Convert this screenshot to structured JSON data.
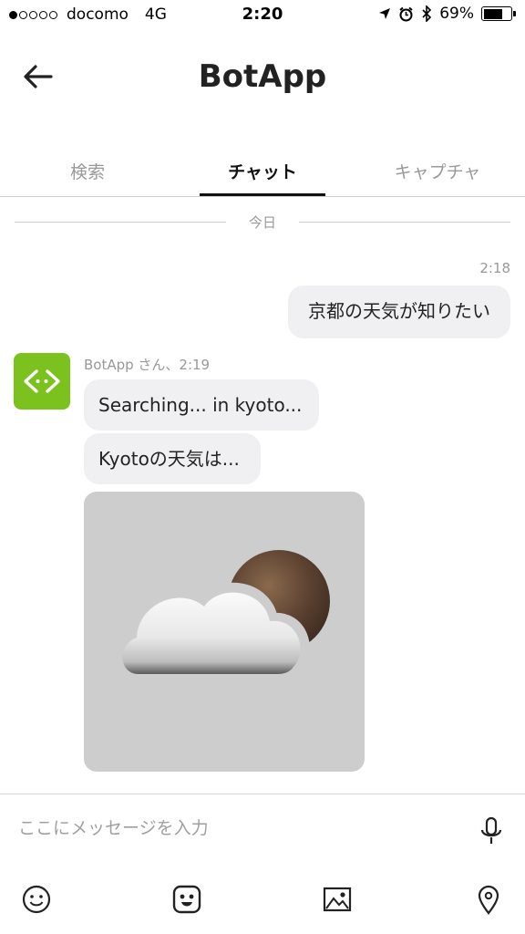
{
  "status_bar": {
    "carrier": "docomo",
    "network": "4G",
    "time": "2:20",
    "battery_percent": "69%",
    "battery_level": 0.69
  },
  "header": {
    "title": "BotApp",
    "back_icon": "back-arrow-icon"
  },
  "tabs": [
    {
      "label": "検索",
      "active": false
    },
    {
      "label": "チャット",
      "active": true
    },
    {
      "label": "キャプチャ",
      "active": false
    }
  ],
  "chat": {
    "date_divider": "今日",
    "messages": [
      {
        "from": "user",
        "time": "2:18",
        "text": "京都の天気が知りたい"
      },
      {
        "from": "bot",
        "meta": "BotApp さん、2:19",
        "text": "Searching... in kyoto..."
      },
      {
        "from": "bot",
        "text": "Kyotoの天気は..."
      },
      {
        "from": "bot",
        "image": "partly-cloudy-weather-icon"
      }
    ]
  },
  "composer": {
    "placeholder": "ここにメッセージを入力",
    "mic_icon": "microphone-icon"
  },
  "toolbar": {
    "icons": [
      "smiley-icon",
      "sticker-icon",
      "image-icon",
      "location-pin-icon"
    ]
  },
  "colors": {
    "avatar": "#7cc21e",
    "bubble": "#f0f0f2",
    "image_background": "#cdcdcd",
    "muted_text": "#999999"
  }
}
